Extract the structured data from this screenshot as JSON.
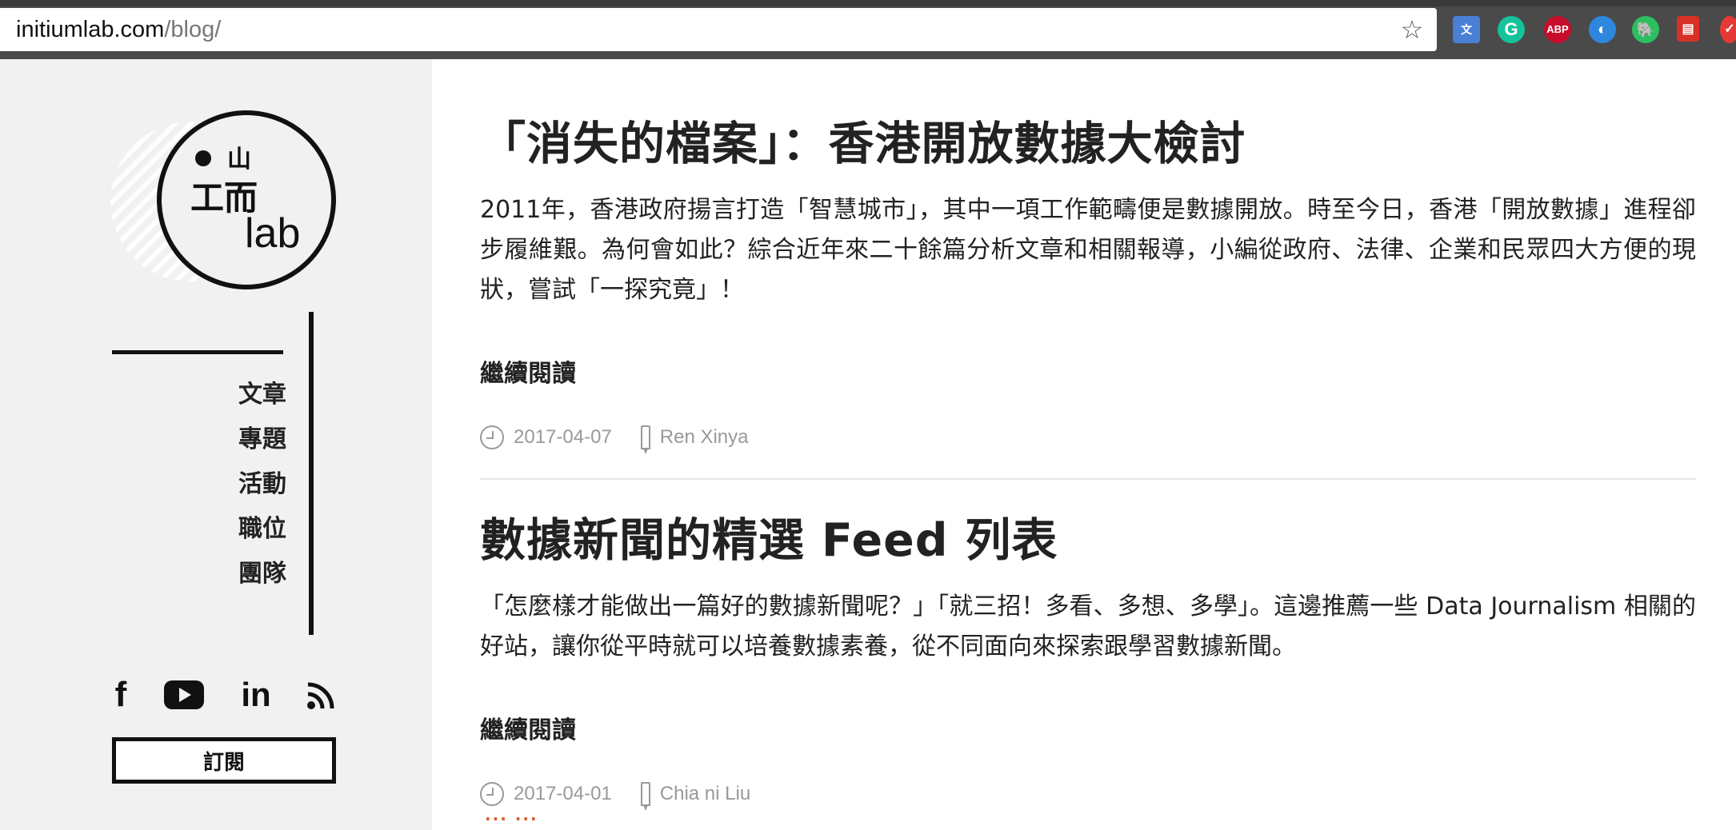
{
  "browser": {
    "url_host": "initiumlab.com",
    "url_path": "/blog/",
    "extensions": [
      "google-translate-icon",
      "grammarly-icon",
      "adblock-plus-icon",
      "browser-ext-icon",
      "evernote-icon",
      "doc-icon",
      "check-icon"
    ],
    "abp_label": "ABP",
    "grammarly_label": "G"
  },
  "sidebar": {
    "logo_text": "lab",
    "logo_glyphs": [
      "山",
      "工",
      "而"
    ],
    "nav": [
      {
        "label": "文章",
        "active": true
      },
      {
        "label": "專題",
        "active": false
      },
      {
        "label": "活動",
        "active": false
      },
      {
        "label": "職位",
        "active": false
      },
      {
        "label": "團隊",
        "active": false
      }
    ],
    "social": {
      "facebook": "f",
      "linkedin": "in"
    },
    "subscribe_label": "訂閱"
  },
  "posts": [
    {
      "title": "「消失的檔案」：香港開放數據大檢討",
      "excerpt": "2011年，香港政府揚言打造「智慧城市」，其中一項工作範疇便是數據開放。時至今日，香港「開放數據」進程卻步履維艱。為何會如此？綜合近年來二十餘篇分析文章和相關報導，小編從政府、法律、企業和民眾四大方便的現狀，嘗試「一探究竟」！",
      "read_more": "繼續閱讀",
      "date": "2017-04-07",
      "author": "Ren Xinya"
    },
    {
      "title": "數據新聞的精選 Feed 列表",
      "excerpt": "「怎麼樣才能做出一篇好的數據新聞呢？」「就三招！多看、多想、多學」。這邊推薦一些 Data Journalism 相關的好站，讓你從平時就可以培養數據素養，從不同面向來探索跟學習數據新聞。",
      "read_more": "繼續閱讀",
      "date": "2017-04-01",
      "author": "Chia ni Liu"
    }
  ],
  "colors": {
    "sidebar_bg": "#f1f1f1",
    "text": "#222222",
    "meta": "#999999",
    "accent": "#e05a2b"
  }
}
